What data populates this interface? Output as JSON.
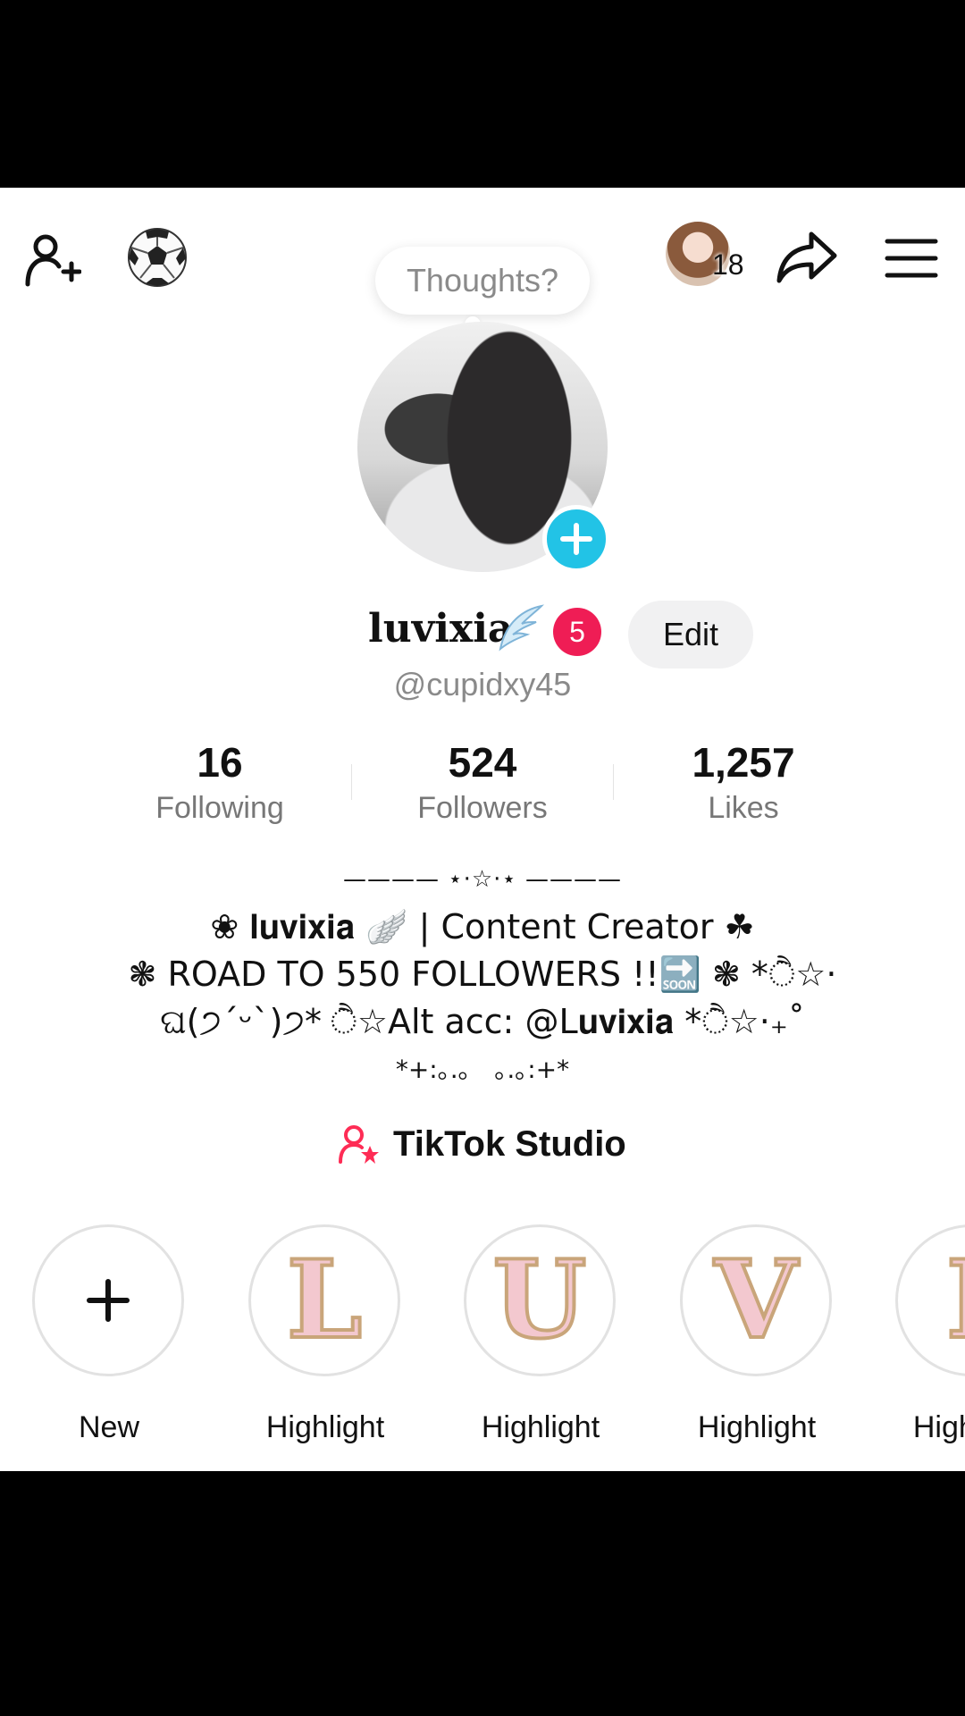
{
  "topbar": {
    "add_friend_icon": "add-person-icon",
    "emoji": "⚽",
    "visitor_count": "18",
    "share_icon": "share-arrow-icon",
    "menu_icon": "hamburger-menu-icon"
  },
  "thoughts_bubble": {
    "placeholder": "Thoughts?"
  },
  "profile": {
    "display_name": "luvixia",
    "name_emoji": "🪽",
    "notification_count": "5",
    "edit_label": "Edit",
    "username": "@cupidxy45"
  },
  "stats": [
    {
      "value": "16",
      "label": "Following"
    },
    {
      "value": "524",
      "label": "Followers"
    },
    {
      "value": "1,257",
      "label": "Likes"
    }
  ],
  "bio": {
    "line1": "———— ⋆·☆·⋆ ————",
    "line2": "❀ 𝐥𝐮𝐯𝐢𝐱𝐢𝐚 🪽 | Content Creator ☘",
    "line3": "❃ ROAD TO 550 FOLLOWERS !!🔜 ❃ *ੈ☆·",
    "line4": "ଘ(੭ˊᵕˋ)੭* ੈ☆Alt acc: @L𝐮𝐯𝐢𝐱𝐢𝐚 *ੈ☆·₊˚",
    "line5": "*+:｡.｡   ｡.｡:+*"
  },
  "studio": {
    "label": "TikTok Studio"
  },
  "highlights": [
    {
      "label": "New",
      "symbol": "+"
    },
    {
      "label": "Highlight",
      "symbol": "L"
    },
    {
      "label": "Highlight",
      "symbol": "U"
    },
    {
      "label": "Highlight",
      "symbol": "V"
    },
    {
      "label": "Highlight",
      "symbol": "I"
    }
  ],
  "colors": {
    "accent_cyan": "#22c3e6",
    "badge_red": "#ef1d55",
    "studio_pink": "#fe2c55"
  }
}
